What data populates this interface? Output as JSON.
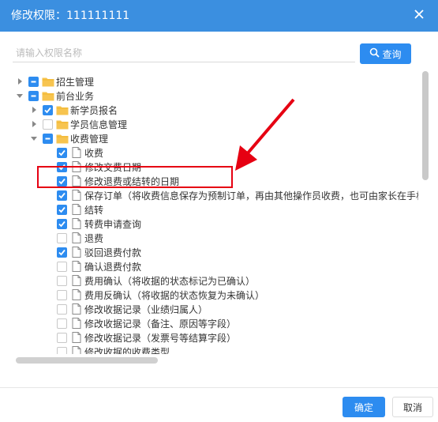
{
  "dialog": {
    "title": "修改权限：111111111",
    "search": {
      "placeholder": "请输入权限名称",
      "value": ""
    },
    "search_button_label": "查询",
    "ok_label": "确定",
    "cancel_label": "取消"
  },
  "tree": [
    {
      "label": "招生管理",
      "level": 0,
      "toggle": "collapsed",
      "check": "partial",
      "icon": "folder-icon"
    },
    {
      "label": "前台业务",
      "level": 0,
      "toggle": "expanded",
      "check": "partial",
      "icon": "folder-icon"
    },
    {
      "label": "新学员报名",
      "level": 1,
      "toggle": "collapsed",
      "check": "checked",
      "icon": "folder-icon"
    },
    {
      "label": "学员信息管理",
      "level": 1,
      "toggle": "collapsed",
      "check": "unchecked",
      "icon": "folder-icon"
    },
    {
      "label": "收费管理",
      "level": 1,
      "toggle": "expanded",
      "check": "partial",
      "icon": "folder-icon"
    },
    {
      "label": "收费",
      "level": 2,
      "toggle": "none",
      "check": "checked",
      "icon": "file-icon"
    },
    {
      "label": "修改交费日期",
      "level": 2,
      "toggle": "none",
      "check": "checked",
      "icon": "file-icon"
    },
    {
      "label": "修改退费或结转的日期",
      "level": 2,
      "toggle": "none",
      "check": "checked",
      "icon": "file-icon"
    },
    {
      "label": "保存订单（将收费信息保存为预制订单，再由其他操作员收费，也可由家长在手机上",
      "level": 2,
      "toggle": "none",
      "check": "checked",
      "icon": "file-icon"
    },
    {
      "label": "结转",
      "level": 2,
      "toggle": "none",
      "check": "checked",
      "icon": "file-icon"
    },
    {
      "label": "转费申请查询",
      "level": 2,
      "toggle": "none",
      "check": "checked",
      "icon": "file-icon"
    },
    {
      "label": "退费",
      "level": 2,
      "toggle": "none",
      "check": "unchecked",
      "icon": "file-icon"
    },
    {
      "label": "驳回退费付款",
      "level": 2,
      "toggle": "none",
      "check": "checked",
      "icon": "file-icon"
    },
    {
      "label": "确认退费付款",
      "level": 2,
      "toggle": "none",
      "check": "unchecked",
      "icon": "file-icon"
    },
    {
      "label": "费用确认（将收据的状态标记为已确认）",
      "level": 2,
      "toggle": "none",
      "check": "unchecked",
      "icon": "file-icon"
    },
    {
      "label": "费用反确认（将收据的状态恢复为未确认）",
      "level": 2,
      "toggle": "none",
      "check": "unchecked",
      "icon": "file-icon"
    },
    {
      "label": "修改收据记录（业绩归属人）",
      "level": 2,
      "toggle": "none",
      "check": "unchecked",
      "icon": "file-icon"
    },
    {
      "label": "修改收据记录（备注、原因等字段）",
      "level": 2,
      "toggle": "none",
      "check": "unchecked",
      "icon": "file-icon"
    },
    {
      "label": "修改收据记录（发票号等结算字段）",
      "level": 2,
      "toggle": "none",
      "check": "unchecked",
      "icon": "file-icon"
    },
    {
      "label": "修改收据的收费类型",
      "level": 2,
      "toggle": "none",
      "check": "unchecked",
      "icon": "file-icon"
    }
  ],
  "colors": {
    "header": "#3b8fe0",
    "primary": "#2d8cf0",
    "highlight": "#e60012",
    "folder": "#f7c44f"
  }
}
